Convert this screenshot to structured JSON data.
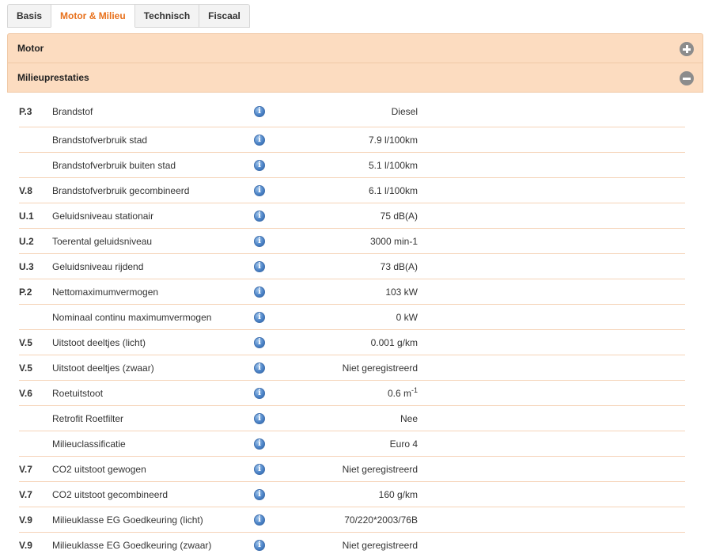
{
  "tabs": [
    {
      "label": "Basis",
      "active": false
    },
    {
      "label": "Motor & Milieu",
      "active": true
    },
    {
      "label": "Technisch",
      "active": false
    },
    {
      "label": "Fiscaal",
      "active": false
    }
  ],
  "panels": {
    "motor": {
      "title": "Motor",
      "state": "collapsed",
      "icon": "plus-circle-icon"
    },
    "milieu": {
      "title": "Milieuprestaties",
      "state": "expanded",
      "icon": "minus-circle-icon"
    }
  },
  "colors": {
    "accent": "#e8711c",
    "header_bg": "#fcdcc0",
    "divider": "#f5d3b8",
    "info": "#4f86c9"
  },
  "rows": [
    {
      "code": "P.3",
      "label": "Brandstof",
      "value": "Diesel"
    },
    {
      "code": "",
      "label": "Brandstofverbruik stad",
      "value": "7.9 l/100km"
    },
    {
      "code": "",
      "label": "Brandstofverbruik buiten stad",
      "value": "5.1 l/100km"
    },
    {
      "code": "V.8",
      "label": "Brandstofverbruik gecombineerd",
      "value": "6.1 l/100km"
    },
    {
      "code": "U.1",
      "label": "Geluidsniveau stationair",
      "value": "75 dB(A)"
    },
    {
      "code": "U.2",
      "label": "Toerental geluidsniveau",
      "value": "3000 min-1"
    },
    {
      "code": "U.3",
      "label": "Geluidsniveau rijdend",
      "value": "73 dB(A)"
    },
    {
      "code": "P.2",
      "label": "Nettomaximumvermogen",
      "value": "103 kW"
    },
    {
      "code": "",
      "label": "Nominaal continu maximumvermogen",
      "value": "0 kW"
    },
    {
      "code": "V.5",
      "label": "Uitstoot deeltjes (licht)",
      "value": "0.001 g/km"
    },
    {
      "code": "V.5",
      "label": "Uitstoot deeltjes (zwaar)",
      "value": "Niet geregistreerd"
    },
    {
      "code": "V.6",
      "label": "Roetuitstoot",
      "value": "0.6 m",
      "value_sup": "-1"
    },
    {
      "code": "",
      "label": "Retrofit Roetfilter",
      "value": "Nee"
    },
    {
      "code": "",
      "label": "Milieuclassificatie",
      "value": "Euro 4"
    },
    {
      "code": "V.7",
      "label": "CO2 uitstoot gewogen",
      "value": "Niet geregistreerd"
    },
    {
      "code": "V.7",
      "label": "CO2 uitstoot gecombineerd",
      "value": "160 g/km"
    },
    {
      "code": "V.9",
      "label": "Milieuklasse EG Goedkeuring (licht)",
      "value": "70/220*2003/76B"
    },
    {
      "code": "V.9",
      "label": "Milieuklasse EG Goedkeuring (zwaar)",
      "value": "Niet geregistreerd"
    }
  ]
}
